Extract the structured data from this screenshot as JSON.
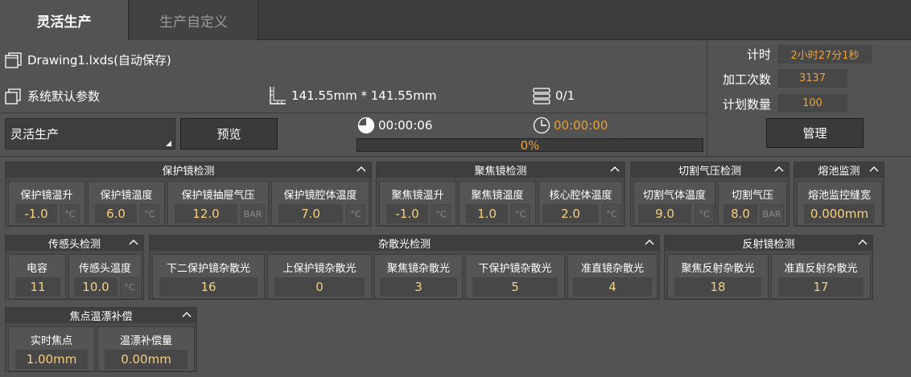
{
  "tabs": [
    {
      "label": "灵活生产"
    },
    {
      "label": "生产自定义"
    }
  ],
  "file": {
    "name": "Drawing1.lxds(自动保存)"
  },
  "params": {
    "name": "系统默认参数"
  },
  "size": {
    "text": "141.55mm * 141.55mm"
  },
  "layers": {
    "text": "0/1"
  },
  "mode": {
    "selected": "灵活生产",
    "preview_label": "预览"
  },
  "timers": {
    "elapsed": "00:00:06",
    "remaining": "00:00:00"
  },
  "progress": {
    "text": "0%",
    "value": 0
  },
  "stats": {
    "timer_label": "计时",
    "timer_value": "2小时27分1秒",
    "count_label": "加工次数",
    "count_value": "3137",
    "plan_label": "计划数量",
    "plan_value": "100",
    "manage_label": "管理"
  },
  "panels": {
    "protect": {
      "title": "保护镜检测",
      "cells": [
        {
          "label": "保护镜温升",
          "value": "-1.0",
          "unit": "°C"
        },
        {
          "label": "保护镜温度",
          "value": "6.0",
          "unit": "°C"
        },
        {
          "label": "保护镜抽屉气压",
          "value": "12.0",
          "unit": "BAR"
        },
        {
          "label": "保护镜腔体温度",
          "value": "7.0",
          "unit": "°C"
        }
      ]
    },
    "focus": {
      "title": "聚焦镜检测",
      "cells": [
        {
          "label": "聚焦镜温升",
          "value": "-1.0",
          "unit": "°C"
        },
        {
          "label": "聚焦镜温度",
          "value": "1.0",
          "unit": "°C"
        },
        {
          "label": "核心腔体温度",
          "value": "2.0",
          "unit": "°C"
        }
      ]
    },
    "gas": {
      "title": "切割气压检测",
      "cells": [
        {
          "label": "切割气体温度",
          "value": "9.0",
          "unit": "°C"
        },
        {
          "label": "切割气压",
          "value": "8.0",
          "unit": "BAR"
        }
      ]
    },
    "pool": {
      "title": "熔池监测",
      "cells": [
        {
          "label": "熔池监控缝宽",
          "value": "0.000mm"
        }
      ]
    },
    "sensor": {
      "title": "传感头检测",
      "cells": [
        {
          "label": "电容",
          "value": "11"
        },
        {
          "label": "传感头温度",
          "value": "10.0",
          "unit": "°C"
        }
      ]
    },
    "stray": {
      "title": "杂散光检测",
      "cells": [
        {
          "label": "下二保护镜杂散光",
          "value": "16"
        },
        {
          "label": "上保护镜杂散光",
          "value": "0"
        },
        {
          "label": "聚焦镜杂散光",
          "value": "3"
        },
        {
          "label": "下保护镜杂散光",
          "value": "5"
        },
        {
          "label": "准直镜杂散光",
          "value": "4"
        }
      ]
    },
    "reflect": {
      "title": "反射镜检测",
      "cells": [
        {
          "label": "聚焦反射杂散光",
          "value": "18"
        },
        {
          "label": "准直反射杂散光",
          "value": "17"
        }
      ]
    },
    "focal": {
      "title": "焦点温漂补偿",
      "cells": [
        {
          "label": "实时焦点",
          "value": "1.00mm"
        },
        {
          "label": "温漂补偿量",
          "value": "0.00mm"
        }
      ]
    }
  },
  "colors": {
    "accent": "#f0a030",
    "value_text": "#f5d080",
    "background": "#535353"
  }
}
